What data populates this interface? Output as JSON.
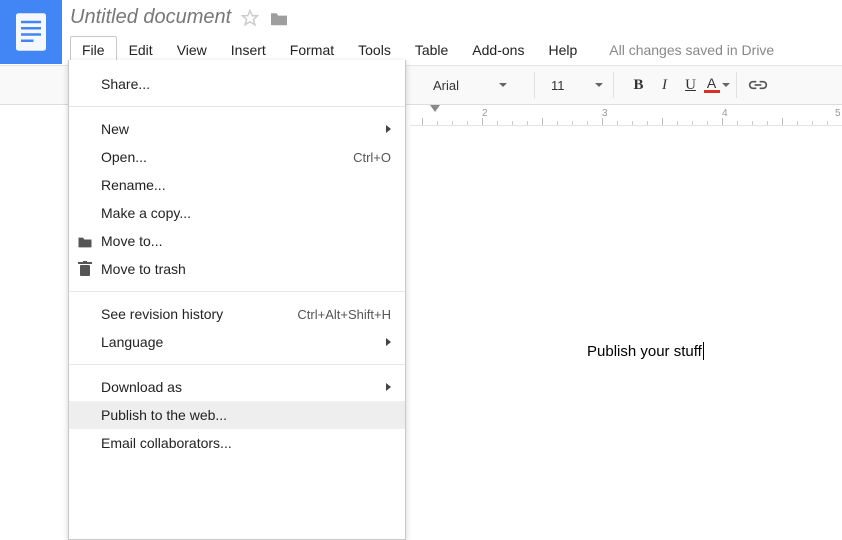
{
  "doc": {
    "title": "Untitled document",
    "content": "Publish your stuff"
  },
  "menu": {
    "items": [
      "File",
      "Edit",
      "View",
      "Insert",
      "Format",
      "Tools",
      "Table",
      "Add-ons",
      "Help"
    ],
    "active": "File",
    "save_status": "All changes saved in Drive"
  },
  "toolbar": {
    "font": "Arial",
    "size": "11",
    "bold": "B",
    "italic": "I",
    "underline": "U",
    "colorLetter": "A"
  },
  "ruler": {
    "labels": [
      "2",
      "3",
      "4",
      "5"
    ]
  },
  "file_menu": {
    "share": "Share...",
    "new": "New",
    "open": "Open...",
    "open_shortcut": "Ctrl+O",
    "rename": "Rename...",
    "make_copy": "Make a copy...",
    "move_to": "Move to...",
    "move_trash": "Move to trash",
    "history": "See revision history",
    "history_shortcut": "Ctrl+Alt+Shift+H",
    "language": "Language",
    "download": "Download as",
    "publish": "Publish to the web...",
    "email": "Email collaborators..."
  }
}
